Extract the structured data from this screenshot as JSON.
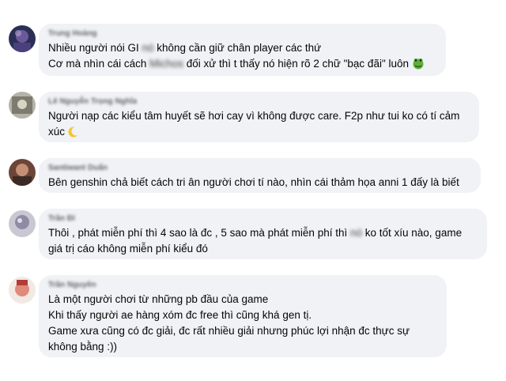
{
  "comments": [
    {
      "author": "Trung Hoàng",
      "avatar_color": "#3a3f7a",
      "lines": {
        "l1_pre": "Nhiều người nói GI ",
        "l1_blur": "nó",
        "l1_post": " không cần giữ chân player các thứ",
        "l2_pre": "Cơ mà nhìn cái cách ",
        "l2_blur": "Michos",
        "l2_post": " đối xử thì t thấy nó hiện rõ 2 chữ \"bạc đãi\" luôn ",
        "emoji": "frog-emoji"
      }
    },
    {
      "author": "Lê Nguyễn Trọng Nghĩa",
      "avatar_color": "#8a8a80",
      "text": "Người nạp các kiểu tâm huyết sẽ hơi cay vì không được care. F2p như tui ko có tí cảm xúc ",
      "emoji": "crescent-emoji"
    },
    {
      "author": "Santiwant Duẩn",
      "avatar_color": "#8a5a4a",
      "text": "Bên genshin chả biết cách tri ân người chơi tí nào, nhìn cái thảm họa anni 1 đấy là biết"
    },
    {
      "author": "Trần Đỉ",
      "avatar_color": "#9a9aa8",
      "lines": {
        "l1_pre": "Thôi , phát miễn phí thì 4 sao là đc , 5 sao mà phát miễn phí thì ",
        "l1_blur": "nó",
        "l1_post": " ko tốt xíu nào, game",
        "l2": "giá trị cáo không miễn phí kiểu đó"
      }
    },
    {
      "author": "Trần Nguyên",
      "avatar_color": "#c0504d",
      "text": "Là một người chơi từ những pb đầu của game\nKhi thấy người ae hàng xóm đc free thì cũng khá gen tị.\nGame xưa cũng có đc giải, đc rất nhiều giải nhưng phúc lợi nhận đc thực sự không bằng :))"
    }
  ]
}
